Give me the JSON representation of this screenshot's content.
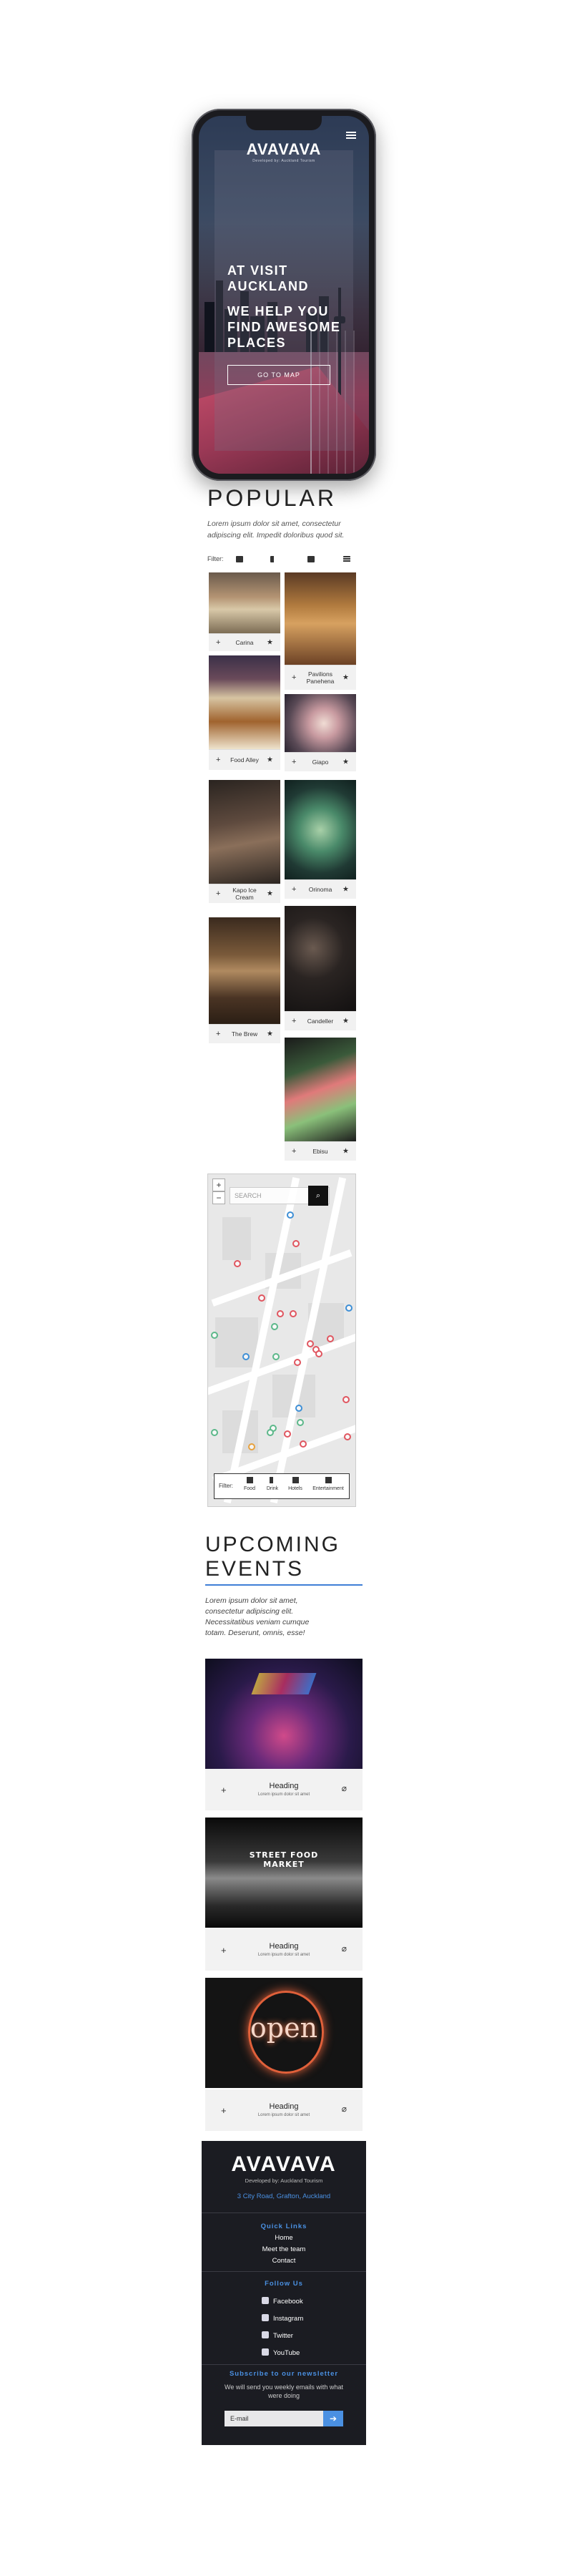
{
  "hero": {
    "logo": "AVAVAVA",
    "tagline": "Developed by: Auckland Tourism",
    "heading1": "AT VISIT AUCKLAND",
    "heading2": "WE HELP YOU FIND AWESOME PLACES",
    "button": "GO TO MAP"
  },
  "popular": {
    "title": "POPULAR",
    "description": "Lorem ipsum dolor sit amet, consectetur adipiscing elit. Impedit doloribus quod sit.",
    "filter_label": "Filter:",
    "cards": [
      {
        "label": "Carina"
      },
      {
        "label": "Pavilions Panehena"
      },
      {
        "label": "Food Alley"
      },
      {
        "label": "Giapo"
      },
      {
        "label": "Kapo Ice Cream"
      },
      {
        "label": "Orinoma"
      },
      {
        "label": "The Brew"
      },
      {
        "label": "Candeller"
      },
      {
        "label": "Ebisu"
      }
    ]
  },
  "map": {
    "search_placeholder": "SEARCH",
    "filter_label": "Filter:",
    "filters": [
      "Food",
      "Drink",
      "Hotels",
      "Entertainment"
    ],
    "pin_colors": {
      "red": "#e0555f",
      "blue": "#3e8fd6",
      "green": "#5cb88a",
      "orange": "#e7a13e"
    }
  },
  "events": {
    "title": "UPCOMING EVENTS",
    "description": "Lorem ipsum dolor sit amet, consectetur adipiscing elit. Necessitatibus veniam cumque totam. Deserunt, omnis, esse!",
    "items": [
      {
        "heading": "Heading",
        "sub": "Lorem ipsum dolor sit amet"
      },
      {
        "heading": "Heading",
        "sub": "Lorem ipsum dolor sit amet"
      },
      {
        "heading": "Heading",
        "sub": "Lorem ipsum dolor sit amet"
      }
    ],
    "image_texts": {
      "market": "STREET FOOD MARKET",
      "open": "open"
    }
  },
  "footer": {
    "logo": "AVAVAVA",
    "tagline": "Developed by: Auckland Tourism",
    "address": "3 City Road, Grafton, Auckland",
    "quick_links_title": "Quick Links",
    "quick_links": [
      "Home",
      "Meet the team",
      "Contact"
    ],
    "follow_title": "Follow Us",
    "social": [
      "Facebook",
      "Instagram",
      "Twitter",
      "YouTube"
    ],
    "newsletter_title": "Subscribe to our newsletter",
    "newsletter_text": "We will send you weekly emails with what were doing",
    "email_placeholder": "E-mail"
  },
  "colors": {
    "accent": "#4a90e2",
    "footer_bg": "#1b1c22"
  }
}
